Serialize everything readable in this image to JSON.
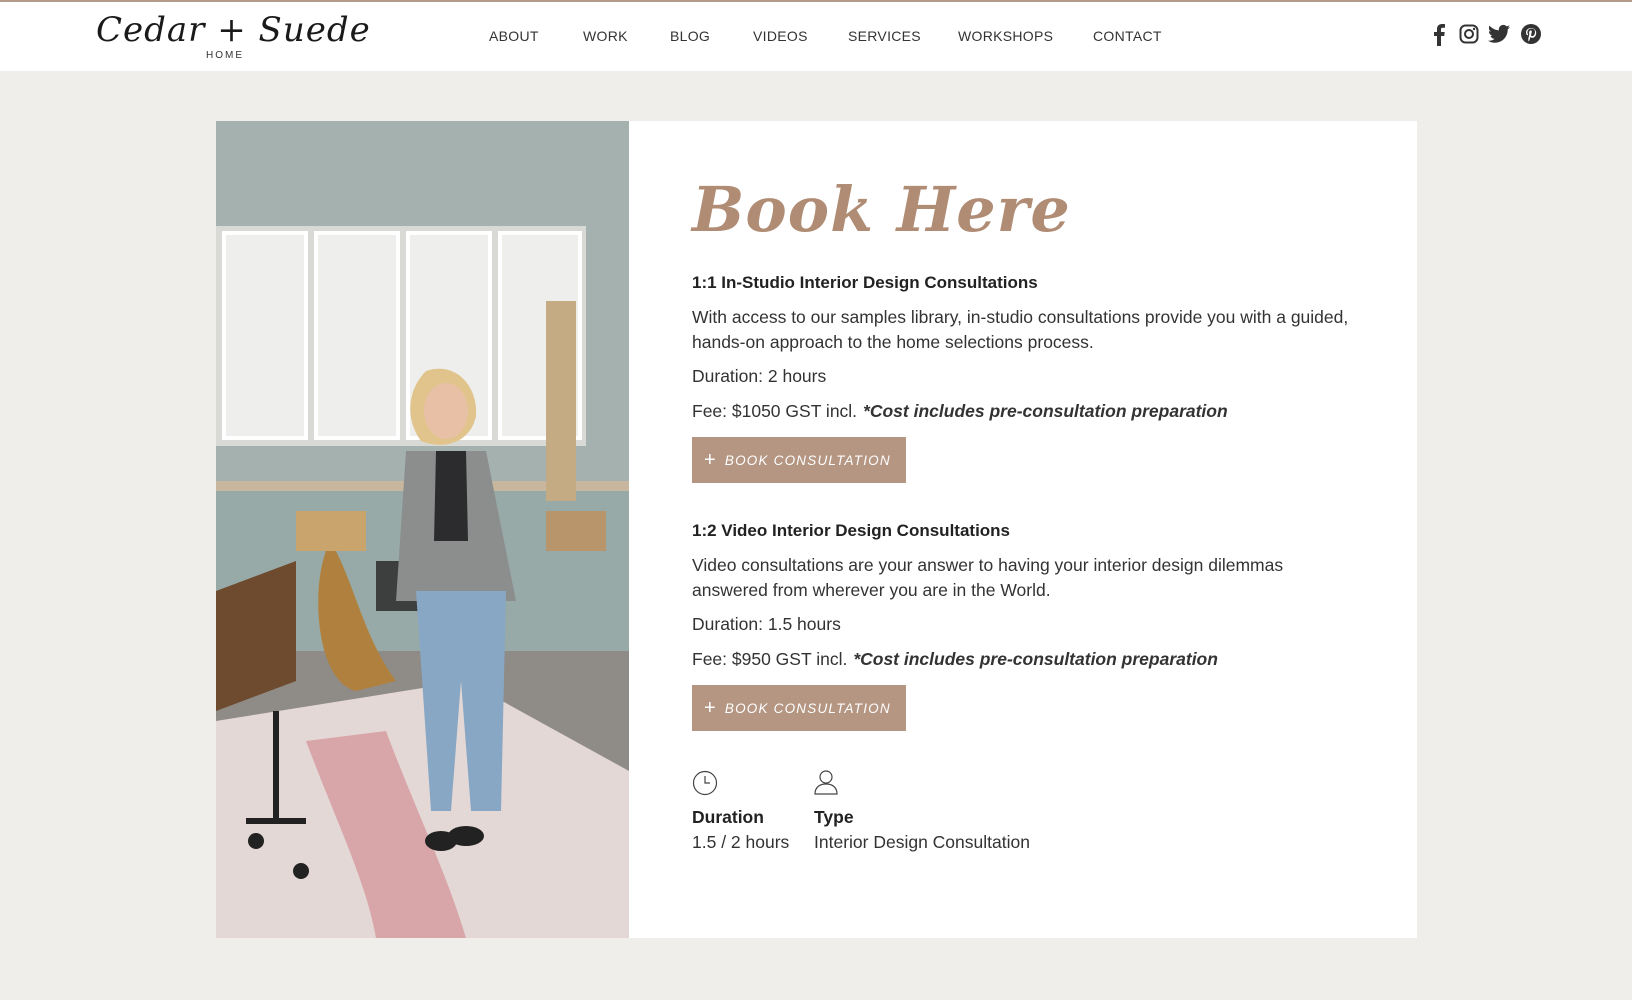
{
  "brand": {
    "logo_script": "Cedar + Suede",
    "logo_sub": "HOME"
  },
  "nav": {
    "items": [
      {
        "label": "ABOUT"
      },
      {
        "label": "WORK"
      },
      {
        "label": "BLOG"
      },
      {
        "label": "VIDEOS"
      },
      {
        "label": "SERVICES"
      },
      {
        "label": "WORKSHOPS"
      },
      {
        "label": "CONTACT"
      }
    ]
  },
  "social": [
    "facebook-icon",
    "instagram-icon",
    "twitter-icon",
    "pinterest-icon"
  ],
  "booking": {
    "title": "Book Here",
    "consultations": [
      {
        "title": "1:1 In-Studio Interior Design Consultations",
        "description": "With access to our samples library, in-studio consultations provide you with a guided, hands-on approach to the home selections process.",
        "duration": "Duration: 2 hours",
        "fee": "Fee: $1050 GST incl.",
        "fee_note": "*Cost includes pre-consultation preparation",
        "button": "BOOK CONSULTATION"
      },
      {
        "title": "1:2 Video Interior Design Consultations",
        "description": "Video consultations are your answer to having your interior design dilemmas answered from wherever you are in the World.",
        "duration": "Duration: 1.5 hours",
        "fee": "Fee: $950 GST incl.",
        "fee_note": "*Cost includes pre-consultation preparation",
        "button": "BOOK CONSULTATION"
      }
    ],
    "meta": {
      "duration_label": "Duration",
      "duration_value": "1.5 / 2 hours",
      "type_label": "Type",
      "type_value": "Interior Design Consultation"
    }
  },
  "colors": {
    "accent": "#b49682",
    "title": "#b08c74",
    "background": "#efeeea"
  }
}
